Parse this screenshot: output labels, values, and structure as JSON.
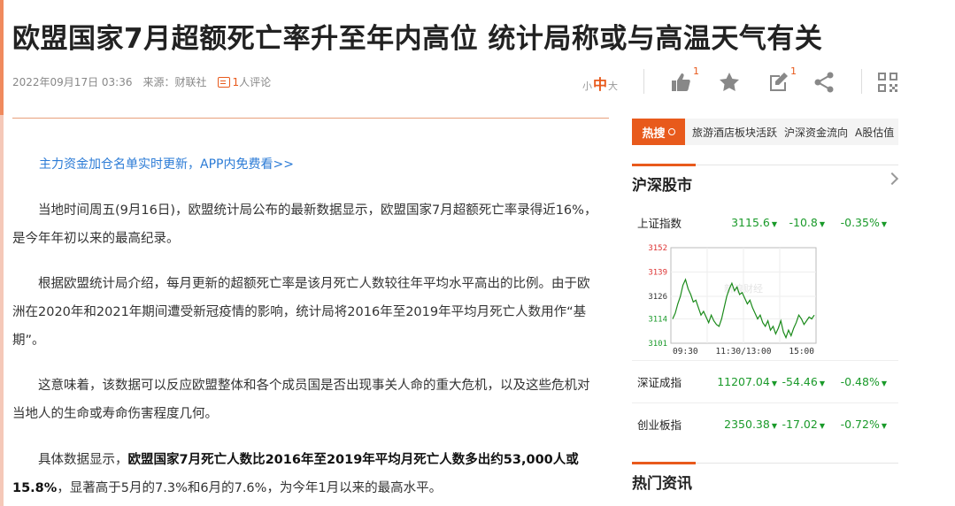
{
  "article": {
    "title": "欧盟国家7月超额死亡率升至年内高位 统计局称或与高温天气有关",
    "date": "2022年09月17日 03:36",
    "source": "来源：财联社",
    "comment_count": "1",
    "comment_label": "人评论",
    "font_size": {
      "small": "小",
      "medium": "中",
      "large": "大"
    },
    "promo_link": "主力资金加仓名单实时更新，APP内免费看>>",
    "paragraphs": [
      "当地时间周五(9月16日)，欧盟统计局公布的最新数据显示，欧盟国家7月超额死亡率录得近16%，是今年年初以来的最高纪录。",
      "根据欧盟统计局介绍，每月更新的超额死亡率是该月死亡人数较往年平均水平高出的比例。由于欧洲在2020年和2021年期间遭受新冠疫情的影响，统计局将2016年至2019年平均月死亡人数用作“基期”。",
      "这意味着，该数据可以反应欧盟整体和各个成员国是否出现事关人命的重大危机，以及这些危机对当地人的生命或寿命伤害程度几何。"
    ],
    "para4_lead": "具体数据显示，",
    "para4_bold": "欧盟国家7月死亡人数比2016年至2019年平均月死亡人数多出约53,000人或15.8%",
    "para4_tail": "，显著高于5月的7.3%和6月的7.6%，为今年1月以来的最高水平。"
  },
  "toolbar": {
    "like_count": "1",
    "edit_count": "1",
    "icons": [
      "thumbs-up-icon",
      "star-icon",
      "edit-icon",
      "share-icon",
      "qrcode-icon"
    ]
  },
  "sidebar": {
    "hot_search_label": "热搜",
    "hot_items": [
      "旅游酒店板块活跃",
      "沪深资金流向",
      "A股估值"
    ],
    "market_title": "沪深股市",
    "indices": [
      {
        "name": "上证指数",
        "value": "3115.6",
        "change": "-10.8",
        "pct": "-0.35%"
      },
      {
        "name": "深证成指",
        "value": "11207.04",
        "change": "-54.46",
        "pct": "-0.48%"
      },
      {
        "name": "创业板指",
        "value": "2350.38",
        "change": "-17.02",
        "pct": "-0.72%"
      }
    ],
    "hot_news_title": "热门资讯"
  },
  "colors": {
    "accent": "#e85a1c",
    "down": "#1a9a2a",
    "link": "#2b7bd6"
  },
  "chart_data": {
    "type": "line",
    "title": "",
    "y_ticks": [
      "3152",
      "3139",
      "3126",
      "3114",
      "3101"
    ],
    "ylim": [
      3101,
      3152
    ],
    "x_ticks": [
      "09:30",
      "11:30/13:00",
      "15:00"
    ],
    "watermark": "新浪财经",
    "series": [
      {
        "values": [
          3114,
          3117,
          3122,
          3126,
          3132,
          3135,
          3130,
          3127,
          3123,
          3124,
          3120,
          3116,
          3118,
          3115,
          3112,
          3116,
          3113,
          3111,
          3110,
          3114,
          3120,
          3126,
          3130,
          3133,
          3129,
          3131,
          3127,
          3128,
          3125,
          3122,
          3124,
          3120,
          3117,
          3114,
          3116,
          3112,
          3110,
          3113,
          3108,
          3110,
          3106,
          3109,
          3113,
          3107,
          3104,
          3108,
          3105,
          3109,
          3112,
          3116,
          3114,
          3111,
          3113,
          3115,
          3114,
          3116
        ]
      }
    ]
  }
}
